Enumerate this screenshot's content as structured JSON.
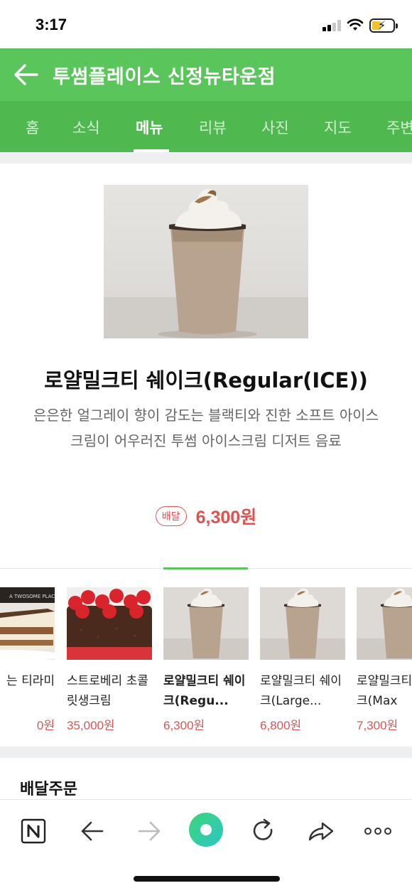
{
  "status_bar": {
    "time": "3:17"
  },
  "header": {
    "title": "투썸플레이스 신정뉴타운점"
  },
  "tabs": [
    {
      "label": "홈"
    },
    {
      "label": "소식"
    },
    {
      "label": "메뉴"
    },
    {
      "label": "리뷰"
    },
    {
      "label": "사진"
    },
    {
      "label": "지도"
    },
    {
      "label": "주변"
    }
  ],
  "active_tab": "메뉴",
  "product": {
    "name": "로얄밀크티 쉐이크(Regular(ICE))",
    "description": "은은한 얼그레이 향이 감도는 블랙티와 진한 소프트 아이스크림이 어우러진 투썸 아이스크림 디저트 음료",
    "badge": "배달",
    "price": "6,300원"
  },
  "carousel": [
    {
      "name": "는 티라미",
      "price": "0원",
      "image": "tiramisu-cake"
    },
    {
      "name": "스트로베리 초콜릿생크림",
      "price": "35,000원",
      "image": "strawberry-chocolate-cake"
    },
    {
      "name": "로얄밀크티 쉐이크(Regu...",
      "price": "6,300원",
      "image": "milk-tea-shake",
      "selected": true
    },
    {
      "name": "로얄밀크티 쉐이크(Large...",
      "price": "6,800원",
      "image": "milk-tea-shake"
    },
    {
      "name": "로얄밀크티 쉐이크(Max",
      "price": "7,300원",
      "image": "milk-tea-shake"
    }
  ],
  "section": {
    "title": "배달주문"
  },
  "browser_bar": {
    "icons": [
      "naver-n-icon",
      "back-icon",
      "forward-icon",
      "home-circle-icon",
      "reload-icon",
      "share-icon",
      "more-icon"
    ]
  },
  "colors": {
    "brand_green": "#5ac55a",
    "price_red": "#e0524f"
  }
}
